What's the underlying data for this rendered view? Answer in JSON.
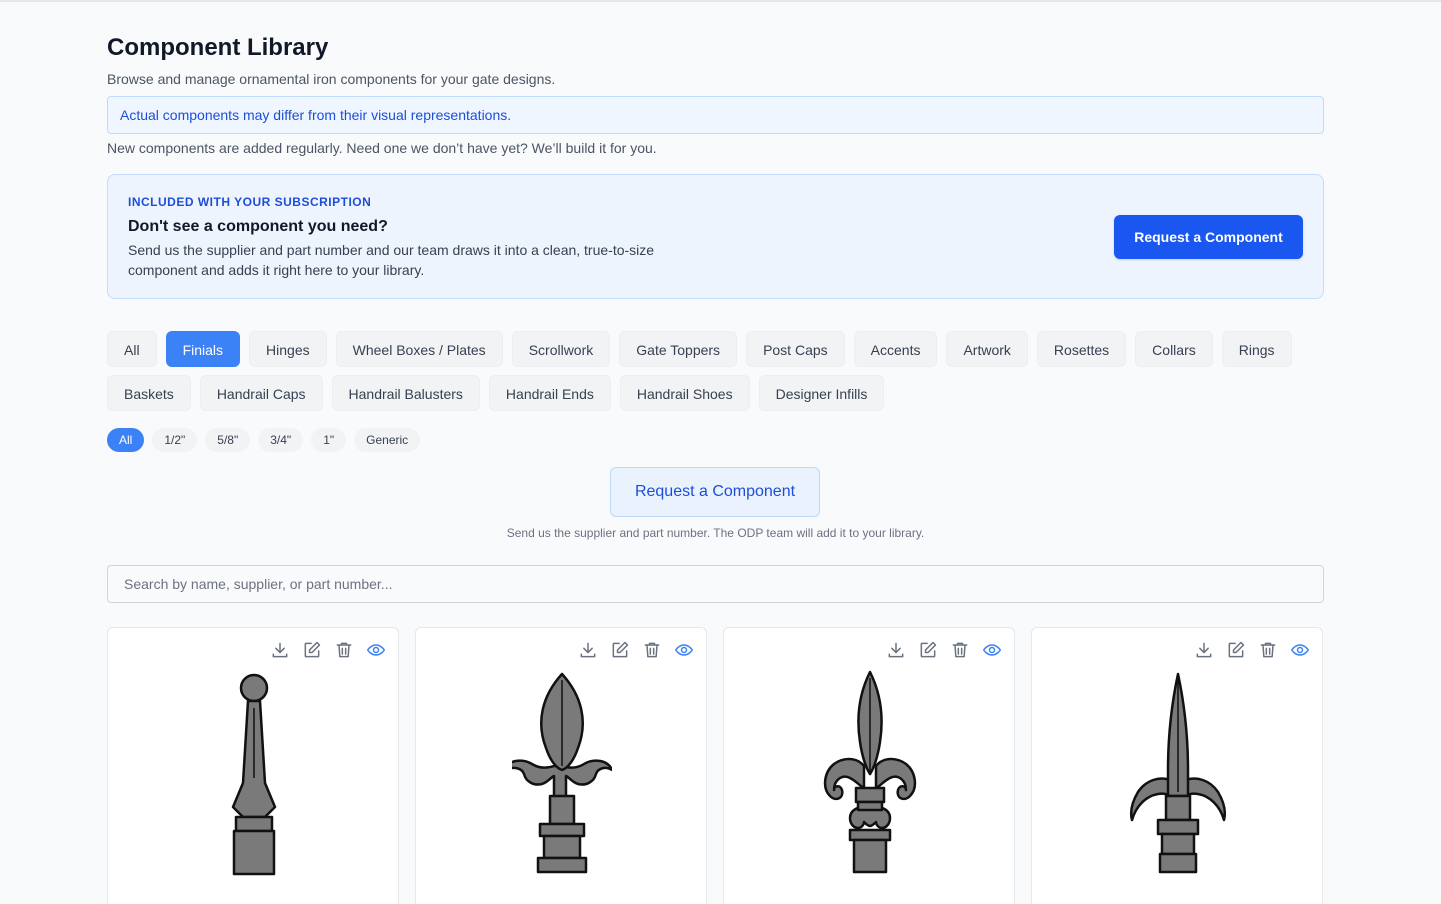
{
  "header": {
    "title": "Component Library",
    "subtitle": "Browse and manage ornamental iron components for your gate designs.",
    "notice": "Actual components may differ from their visual representations.",
    "new_note": "New components are added regularly. Need one we don’t have yet? We’ll build it for you."
  },
  "promo": {
    "eyebrow": "INCLUDED WITH YOUR SUBSCRIPTION",
    "title": "Don't see a component you need?",
    "body": "Send us the supplier and part number and our team draws it into a clean, true-to-size component and adds it right here to your library.",
    "button": "Request a Component"
  },
  "categories": [
    {
      "label": "All",
      "active": false
    },
    {
      "label": "Finials",
      "active": true
    },
    {
      "label": "Hinges",
      "active": false
    },
    {
      "label": "Wheel Boxes / Plates",
      "active": false
    },
    {
      "label": "Scrollwork",
      "active": false
    },
    {
      "label": "Gate Toppers",
      "active": false
    },
    {
      "label": "Post Caps",
      "active": false
    },
    {
      "label": "Accents",
      "active": false
    },
    {
      "label": "Artwork",
      "active": false
    },
    {
      "label": "Rosettes",
      "active": false
    },
    {
      "label": "Collars",
      "active": false
    },
    {
      "label": "Rings",
      "active": false
    },
    {
      "label": "Baskets",
      "active": false
    },
    {
      "label": "Handrail Caps",
      "active": false
    },
    {
      "label": "Handrail Balusters",
      "active": false
    },
    {
      "label": "Handrail Ends",
      "active": false
    },
    {
      "label": "Handrail Shoes",
      "active": false
    },
    {
      "label": "Designer Infills",
      "active": false
    }
  ],
  "sizes": [
    {
      "label": "All",
      "active": true
    },
    {
      "label": "1/2\"",
      "active": false
    },
    {
      "label": "5/8\"",
      "active": false
    },
    {
      "label": "3/4\"",
      "active": false
    },
    {
      "label": "1\"",
      "active": false
    },
    {
      "label": "Generic",
      "active": false
    }
  ],
  "request": {
    "button": "Request a Component",
    "help": "Send us the supplier and part number. The ODP team will add it to your library."
  },
  "search": {
    "placeholder": "Search by name, supplier, or part number...",
    "value": ""
  },
  "cards": [
    {
      "image": "ball-top-finial-icon"
    },
    {
      "image": "tulip-finial-icon"
    },
    {
      "image": "fleur-de-lis-finial-icon"
    },
    {
      "image": "spear-finial-icon"
    }
  ],
  "card_actions": [
    "download-icon",
    "edit-icon",
    "delete-icon",
    "view-icon"
  ],
  "colors": {
    "primary": "#1a56f0",
    "active_chip": "#3b82f6",
    "view_icon": "#3b82f6",
    "component_fill": "#7a7a7a"
  }
}
